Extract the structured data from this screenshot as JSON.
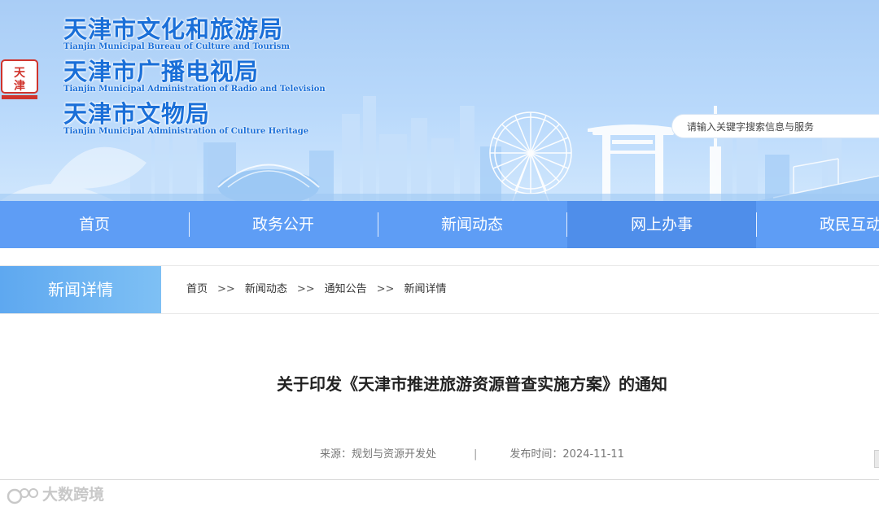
{
  "header": {
    "titles": [
      {
        "cn": "天津市文化和旅游局",
        "en": "Tianjin Municipal Bureau of Culture and Tourism"
      },
      {
        "cn": "天津市广播电视局",
        "en": "Tianjin Municipal Administration of Radio and Television"
      },
      {
        "cn": "天津市文物局",
        "en": "Tianjin Municipal Administration of Culture Heritage"
      }
    ],
    "seal_text": "天津",
    "search": {
      "placeholder": "请输入关键字搜索信息与服务",
      "value": ""
    }
  },
  "nav": {
    "items": [
      {
        "label": "首页"
      },
      {
        "label": "政务公开"
      },
      {
        "label": "新闻动态"
      },
      {
        "label": "网上办事"
      },
      {
        "label": "政民互动"
      }
    ],
    "active_index": 3
  },
  "section": {
    "label": "新闻详情"
  },
  "breadcrumb": {
    "items": [
      "首页",
      "新闻动态",
      "通知公告",
      "新闻详情"
    ],
    "separator": ">>"
  },
  "article": {
    "title": "关于印发《天津市推进旅游资源普查实施方案》的通知",
    "source": "来源：规划与资源开发处",
    "divider": "|",
    "published": "发布时间：2024-11-11"
  },
  "watermark": {
    "text": "大数跨境"
  },
  "colors": {
    "nav_bg": "#5e9df5",
    "nav_active": "#4f8eea",
    "title_blue": "#1a6fd8",
    "header_sky": "#b9d9fb"
  }
}
